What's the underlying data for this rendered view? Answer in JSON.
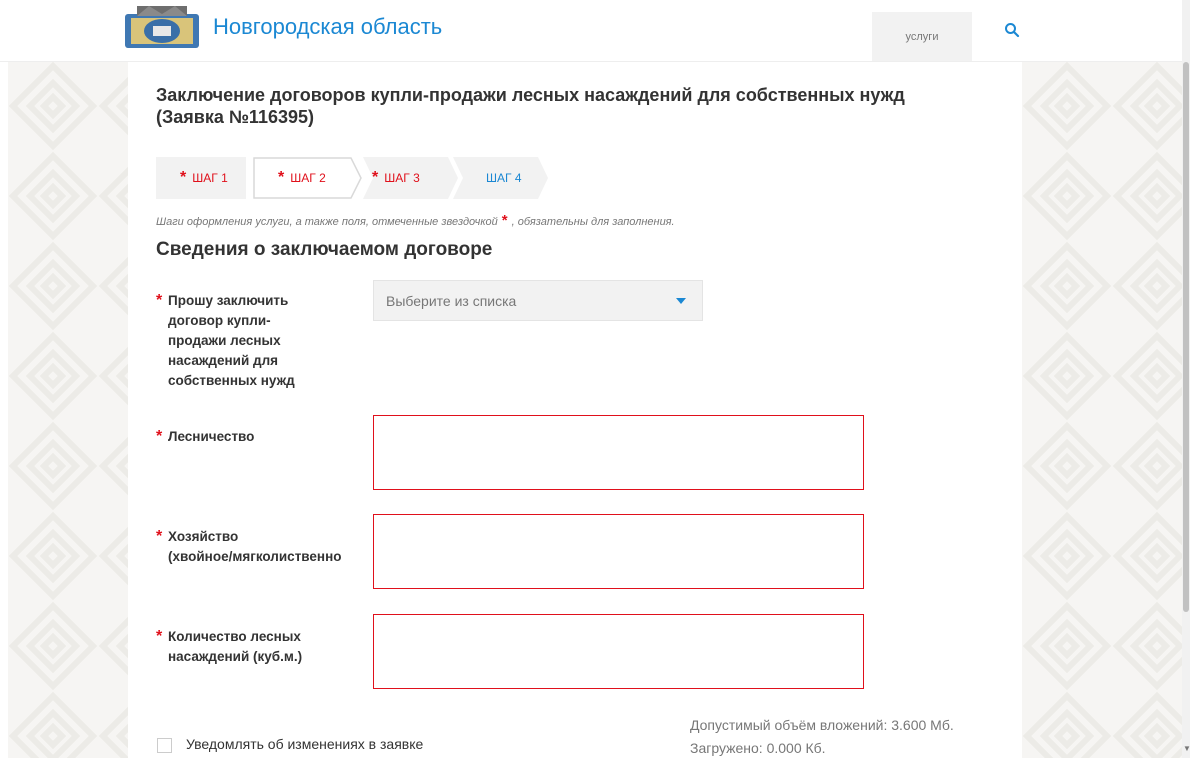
{
  "header": {
    "region_title": "Новгородская область",
    "services_label": "услуги"
  },
  "page": {
    "title_line1": "Заключение договоров купли-продажи лесных насаждений для собственных нужд",
    "title_line2": "(Заявка №116395)"
  },
  "steps": [
    {
      "label": "ШАГ 1",
      "required": true
    },
    {
      "label": "ШАГ 2",
      "required": true,
      "active": true
    },
    {
      "label": "ШАГ 3",
      "required": true
    },
    {
      "label": "ШАГ 4",
      "required": false
    }
  ],
  "hint": {
    "before": "Шаги оформления услуги, а также поля, отмеченные звездочкой",
    "after": ", обязательны для заполнения."
  },
  "section_title": "Сведения о заключаемом договоре",
  "fields": {
    "contract_type": {
      "label_lines": [
        "Прошу заключить",
        "договор купли-",
        "продажи лесных",
        "насаждений для",
        "собственных нужд"
      ],
      "placeholder": "Выберите из списка"
    },
    "forestry": {
      "label": "Лесничество",
      "value": ""
    },
    "farm": {
      "label_lines": [
        "Хозяйство",
        "(хвойное/мягколиственно"
      ],
      "value": ""
    },
    "volume": {
      "label_lines": [
        "Количество лесных",
        "насаждений (куб.м.)"
      ],
      "value": ""
    }
  },
  "notify_label": "Уведомлять об изменениях в заявке",
  "upload": {
    "limit": "Допустимый объём вложений: 3.600 Мб.",
    "loaded": "Загружено: 0.000 Кб."
  },
  "colors": {
    "accent": "#1b88d3",
    "required": "#e0101b",
    "text": "#333333"
  },
  "icons": {
    "search": "magnifier",
    "logo": "coat-of-arms",
    "select_caret": "caret-down"
  }
}
